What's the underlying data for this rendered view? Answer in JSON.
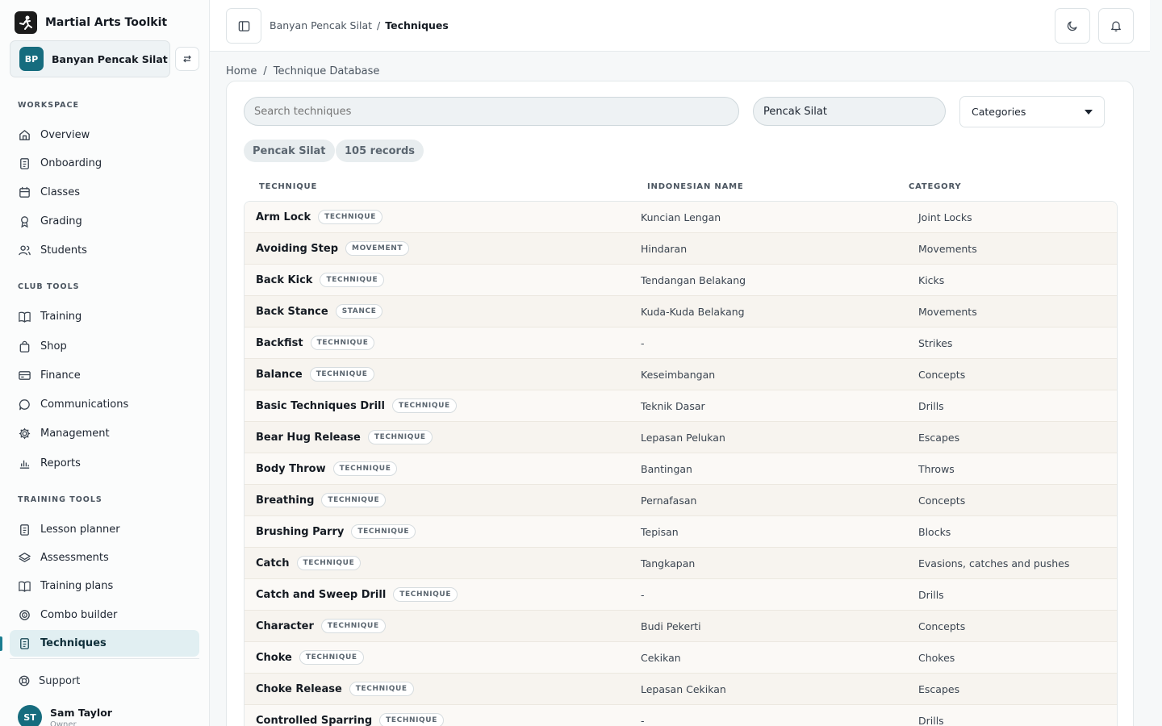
{
  "app": {
    "name": "Martial Arts Toolkit"
  },
  "club": {
    "initials": "BP",
    "name": "Banyan Pencak Silat"
  },
  "sidebar": {
    "sections": [
      {
        "label": "WORKSPACE"
      },
      {
        "label": "CLUB TOOLS"
      },
      {
        "label": "TRAINING TOOLS"
      }
    ],
    "items": [
      {
        "label": "Overview",
        "icon": "home-icon"
      },
      {
        "label": "Onboarding",
        "icon": "clipboard-icon"
      },
      {
        "label": "Classes",
        "icon": "calendar-icon"
      },
      {
        "label": "Grading",
        "icon": "award-icon"
      },
      {
        "label": "Students",
        "icon": "users-icon"
      },
      {
        "label": "Training",
        "icon": "book-icon"
      },
      {
        "label": "Shop",
        "icon": "bag-icon"
      },
      {
        "label": "Finance",
        "icon": "card-icon"
      },
      {
        "label": "Communications",
        "icon": "message-icon"
      },
      {
        "label": "Management",
        "icon": "gear-icon"
      },
      {
        "label": "Reports",
        "icon": "bar-chart-icon"
      },
      {
        "label": "Lesson planner",
        "icon": "clipboard-icon"
      },
      {
        "label": "Assessments",
        "icon": "layers-icon"
      },
      {
        "label": "Training plans",
        "icon": "book-icon"
      },
      {
        "label": "Combo builder",
        "icon": "target-icon"
      },
      {
        "label": "Techniques",
        "icon": "file-icon"
      }
    ],
    "support": "Support",
    "user": {
      "initials": "ST",
      "name": "Sam Taylor",
      "role": "Owner"
    }
  },
  "topbar": {
    "crumb_parent": "Banyan Pencak Silat",
    "crumb_sep": "/",
    "crumb_current": "Techniques"
  },
  "breadcrumb": {
    "home": "Home",
    "sep": "/",
    "current": "Technique Database"
  },
  "filters": {
    "search_placeholder": "Search techniques",
    "style_value": "Pencak Silat",
    "categories_label": "Categories"
  },
  "chips": {
    "style": "Pencak Silat",
    "count": "105 records"
  },
  "table": {
    "headers": {
      "technique": "TECHNIQUE",
      "indonesian": "INDONESIAN NAME",
      "category": "CATEGORY"
    },
    "rows": [
      {
        "name": "Arm Lock",
        "tag": "TECHNIQUE",
        "indo": "Kuncian Lengan",
        "cat": "Joint Locks"
      },
      {
        "name": "Avoiding Step",
        "tag": "MOVEMENT",
        "indo": "Hindaran",
        "cat": "Movements"
      },
      {
        "name": "Back Kick",
        "tag": "TECHNIQUE",
        "indo": "Tendangan Belakang",
        "cat": "Kicks"
      },
      {
        "name": "Back Stance",
        "tag": "STANCE",
        "indo": "Kuda-Kuda Belakang",
        "cat": "Movements"
      },
      {
        "name": "Backfist",
        "tag": "TECHNIQUE",
        "indo": "-",
        "cat": "Strikes"
      },
      {
        "name": "Balance",
        "tag": "TECHNIQUE",
        "indo": "Keseimbangan",
        "cat": "Concepts"
      },
      {
        "name": "Basic Techniques Drill",
        "tag": "TECHNIQUE",
        "indo": "Teknik Dasar",
        "cat": "Drills"
      },
      {
        "name": "Bear Hug Release",
        "tag": "TECHNIQUE",
        "indo": "Lepasan Pelukan",
        "cat": "Escapes"
      },
      {
        "name": "Body Throw",
        "tag": "TECHNIQUE",
        "indo": "Bantingan",
        "cat": "Throws"
      },
      {
        "name": "Breathing",
        "tag": "TECHNIQUE",
        "indo": "Pernafasan",
        "cat": "Concepts"
      },
      {
        "name": "Brushing Parry",
        "tag": "TECHNIQUE",
        "indo": "Tepisan",
        "cat": "Blocks"
      },
      {
        "name": "Catch",
        "tag": "TECHNIQUE",
        "indo": "Tangkapan",
        "cat": "Evasions, catches and pushes"
      },
      {
        "name": "Catch and Sweep Drill",
        "tag": "TECHNIQUE",
        "indo": "-",
        "cat": "Drills"
      },
      {
        "name": "Character",
        "tag": "TECHNIQUE",
        "indo": "Budi Pekerti",
        "cat": "Concepts"
      },
      {
        "name": "Choke",
        "tag": "TECHNIQUE",
        "indo": "Cekikan",
        "cat": "Chokes"
      },
      {
        "name": "Choke Release",
        "tag": "TECHNIQUE",
        "indo": "Lepasan Cekikan",
        "cat": "Escapes"
      },
      {
        "name": "Controlled Sparring",
        "tag": "TECHNIQUE",
        "indo": "-",
        "cat": "Drills"
      }
    ]
  },
  "colors": {
    "accent": "#166c7e",
    "active_bg": "#e1eff2",
    "row_bg": "#fbf9f6"
  }
}
